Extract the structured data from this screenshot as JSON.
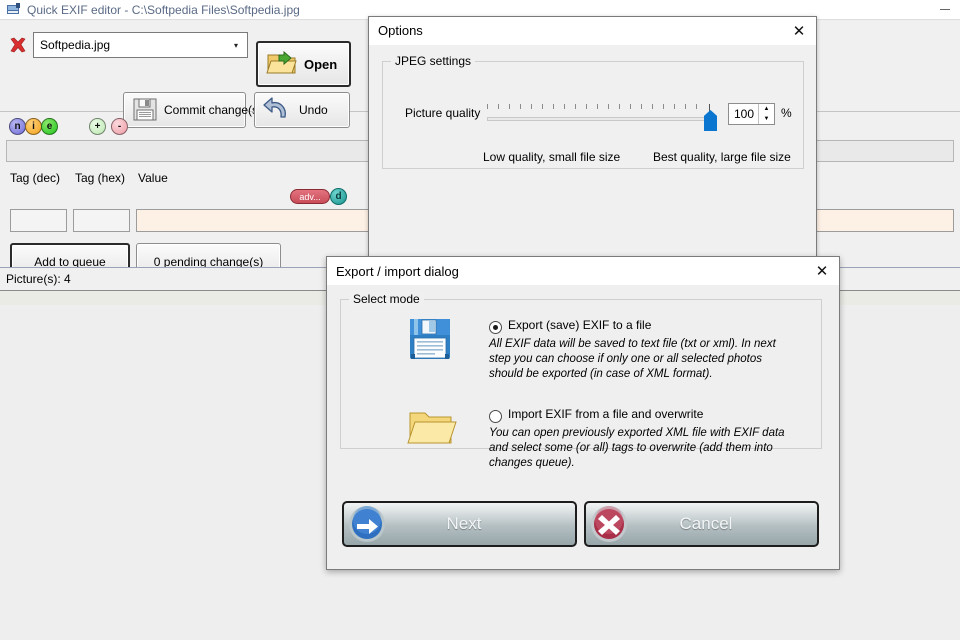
{
  "main_window": {
    "title": "Quick EXIF editor - C:\\Softpedia Files\\Softpedia.jpg",
    "icon": "app-icon",
    "minimize_label": "Minimize",
    "toolbar": {
      "remove_icon": "red-x-icon",
      "file_combo_value": "Softpedia.jpg",
      "file_combo_arrow": "▾",
      "open_label": "Open",
      "open_icon": "open-folder-icon",
      "commit_label": "Commit change(s)...",
      "commit_icon": "floppy-save-icon",
      "undo_label": "Undo",
      "undo_icon": "undo-arrow-icon"
    },
    "markers": [
      {
        "letter": "n",
        "name": "marker-n"
      },
      {
        "letter": "i",
        "name": "marker-i"
      },
      {
        "letter": "e",
        "name": "marker-e"
      },
      {
        "letter": "+",
        "name": "marker-add"
      },
      {
        "letter": "-",
        "name": "marker-remove"
      }
    ],
    "tag_editor": {
      "label_dec": "Tag (dec)",
      "label_hex": "Tag (hex)",
      "label_value": "Value",
      "adv_badge": "adv...",
      "d_badge": "d",
      "value_dec": "",
      "value_hex": "",
      "value_value": ""
    },
    "actions": {
      "add_to_queue": "Add to queue",
      "pending_changes": "0 pending change(s)"
    },
    "status": "Picture(s): 4"
  },
  "options_dialog": {
    "title": "Options",
    "close_label": "✕",
    "group_legend": "JPEG settings",
    "quality_label": "Picture quality",
    "quality_value": "100",
    "percent_symbol": "%",
    "hint_low": "Low quality, small file size",
    "hint_high": "Best quality, large file size",
    "spinner_up": "▲",
    "spinner_down": "▼"
  },
  "export_dialog": {
    "title": "Export / import dialog",
    "close_label": "✕",
    "group_legend": "Select mode",
    "options": [
      {
        "icon": "floppy-disk-icon",
        "selected": true,
        "label": "Export (save) EXIF to a file",
        "description": "All EXIF data will be saved to text file (txt or xml). In next step you can choose if only one or all selected photos should be exported (in case of XML format)."
      },
      {
        "icon": "open-folder-icon",
        "selected": false,
        "label": "Import EXIF from a file and overwrite",
        "description": "You can open previously exported XML file with EXIF data and select some (or all) tags to overwrite (add them into changes queue)."
      }
    ],
    "buttons": {
      "next_label": "Next",
      "next_icon": "blue-arrow-right-icon",
      "cancel_label": "Cancel",
      "cancel_icon": "red-x-circle-icon"
    }
  },
  "colors": {
    "accent_blue": "#0a76d0",
    "value_field": "#fdf0e4",
    "adv_badge": "#c94c5a",
    "d_badge": "#17928d",
    "title_text": "#5a6a86",
    "desktop": "#e8e8e2"
  }
}
